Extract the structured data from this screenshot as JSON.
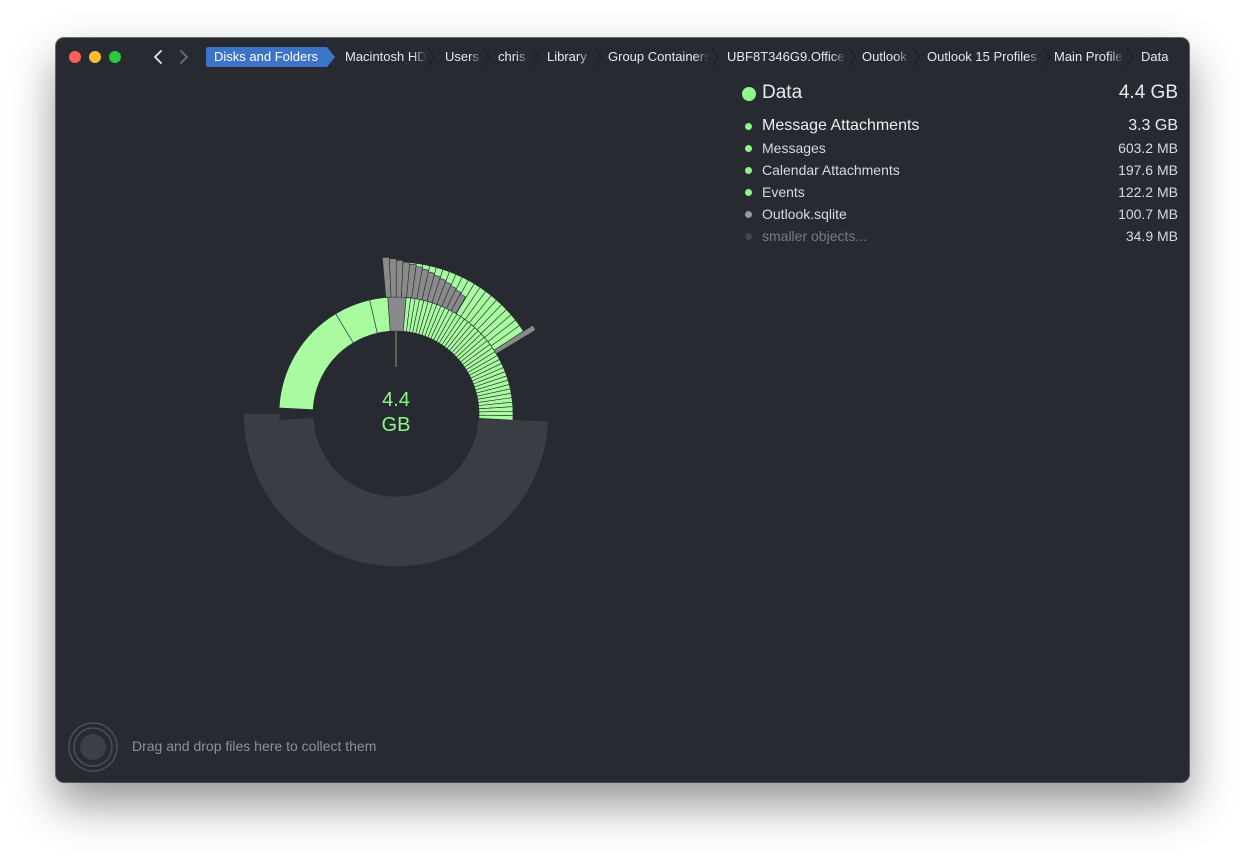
{
  "titlebar": {
    "breadcrumbs": [
      "Disks and Folders",
      "Macintosh HD",
      "Users",
      "chris",
      "Library",
      "Group Containers",
      "UBF8T346G9.Office",
      "Outlook",
      "Outlook 15 Profiles",
      "Main Profile",
      "Data"
    ]
  },
  "chart": {
    "center_value": "4.4",
    "center_unit": "GB"
  },
  "summary": {
    "title": "Data",
    "total": "4.4 GB",
    "items": [
      {
        "label": "Message Attachments",
        "size": "3.3 GB",
        "color": "#8ef78a"
      },
      {
        "label": "Messages",
        "size": "603.2  MB",
        "color": "#8ef78a"
      },
      {
        "label": "Calendar Attachments",
        "size": "197.6  MB",
        "color": "#8ef78a"
      },
      {
        "label": "Events",
        "size": "122.2  MB",
        "color": "#8ef78a"
      },
      {
        "label": "Outlook.sqlite",
        "size": "100.7  MB",
        "color": "#9a9a9a"
      },
      {
        "label": "smaller objects...",
        "size": "34.9  MB",
        "color": "#42464d"
      }
    ]
  },
  "footer": {
    "drop_text": "Drag and drop files here to collect them"
  },
  "colors": {
    "accent": "#3b74c8",
    "folder_green": "#8ef78a",
    "light_green": "#a8fb9f",
    "file_gray": "#8a8a8a",
    "background": "#272a31"
  }
}
